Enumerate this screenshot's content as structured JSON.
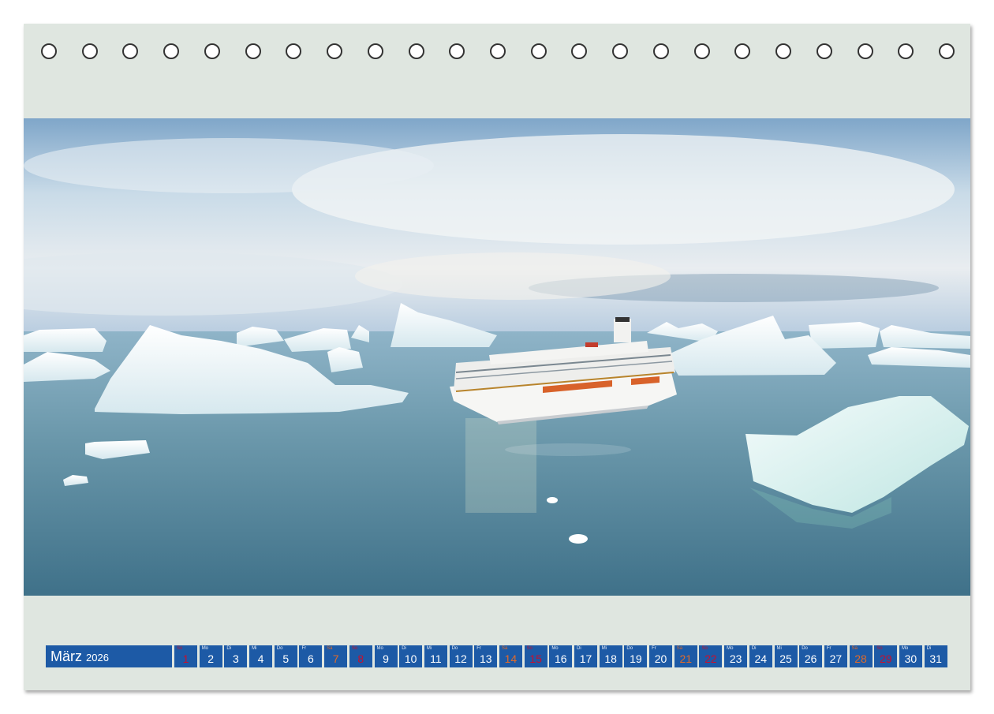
{
  "hole_count": 23,
  "calendar": {
    "month": "März",
    "year": "2026",
    "days": [
      {
        "wd": "So",
        "n": "1",
        "type": "sun"
      },
      {
        "wd": "Mo",
        "n": "2",
        "type": "weekday"
      },
      {
        "wd": "Di",
        "n": "3",
        "type": "weekday"
      },
      {
        "wd": "Mi",
        "n": "4",
        "type": "weekday"
      },
      {
        "wd": "Do",
        "n": "5",
        "type": "weekday"
      },
      {
        "wd": "Fr",
        "n": "6",
        "type": "weekday"
      },
      {
        "wd": "Sa",
        "n": "7",
        "type": "sat"
      },
      {
        "wd": "So",
        "n": "8",
        "type": "sun"
      },
      {
        "wd": "Mo",
        "n": "9",
        "type": "weekday"
      },
      {
        "wd": "Di",
        "n": "10",
        "type": "weekday"
      },
      {
        "wd": "Mi",
        "n": "11",
        "type": "weekday"
      },
      {
        "wd": "Do",
        "n": "12",
        "type": "weekday"
      },
      {
        "wd": "Fr",
        "n": "13",
        "type": "weekday"
      },
      {
        "wd": "Sa",
        "n": "14",
        "type": "sat"
      },
      {
        "wd": "So",
        "n": "15",
        "type": "sun"
      },
      {
        "wd": "Mo",
        "n": "16",
        "type": "weekday"
      },
      {
        "wd": "Di",
        "n": "17",
        "type": "weekday"
      },
      {
        "wd": "Mi",
        "n": "18",
        "type": "weekday"
      },
      {
        "wd": "Do",
        "n": "19",
        "type": "weekday"
      },
      {
        "wd": "Fr",
        "n": "20",
        "type": "weekday"
      },
      {
        "wd": "Sa",
        "n": "21",
        "type": "sat"
      },
      {
        "wd": "So",
        "n": "22",
        "type": "sun"
      },
      {
        "wd": "Mo",
        "n": "23",
        "type": "weekday"
      },
      {
        "wd": "Di",
        "n": "24",
        "type": "weekday"
      },
      {
        "wd": "Mi",
        "n": "25",
        "type": "weekday"
      },
      {
        "wd": "Do",
        "n": "26",
        "type": "weekday"
      },
      {
        "wd": "Fr",
        "n": "27",
        "type": "weekday"
      },
      {
        "wd": "Sa",
        "n": "28",
        "type": "sat"
      },
      {
        "wd": "So",
        "n": "29",
        "type": "sun"
      },
      {
        "wd": "Mo",
        "n": "30",
        "type": "weekday"
      },
      {
        "wd": "Di",
        "n": "31",
        "type": "weekday"
      }
    ]
  },
  "colors": {
    "sheet": "#dfe6e0",
    "calendar_bar": "#1d5aa6",
    "saturday": "#e06a2a",
    "sunday": "#c8102e"
  }
}
